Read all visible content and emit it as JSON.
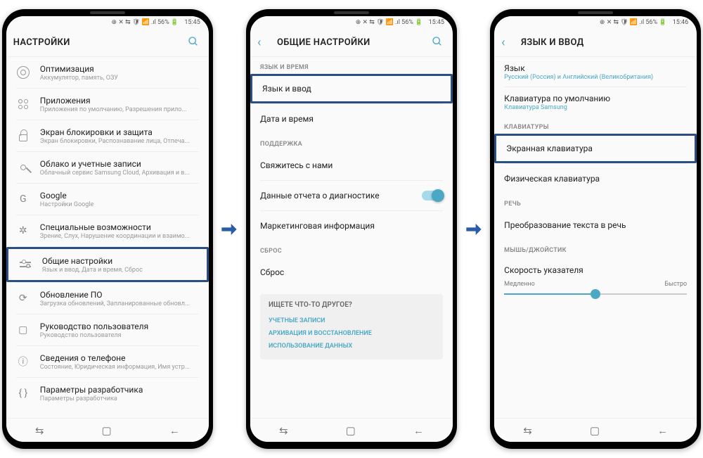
{
  "status": {
    "icons": "⊕ ✕ ⇆ 🛡 📶 .ıl 56% 🔋",
    "time1": "15:45",
    "time2": "15:45",
    "time3": "15:46"
  },
  "phone1": {
    "title": "НАСТРОЙКИ",
    "items": [
      {
        "title": "Оптимизация",
        "sub": "Аккумулятор, память, ОЗУ"
      },
      {
        "title": "Приложения",
        "sub": "Приложения по умолчанию, Разрешения прило..."
      },
      {
        "title": "Экран блокировки и защита",
        "sub": "Экран блокировки, Распознавание лица, Отпеча..."
      },
      {
        "title": "Облако и учетные записи",
        "sub": "Облачный сервис Samsung Cloud, Архивация и в..."
      },
      {
        "title": "Google",
        "sub": "Настройки Google"
      },
      {
        "title": "Специальные возможности",
        "sub": "Зрение, Слух, Нарушение координации и взаимо..."
      },
      {
        "title": "Общие настройки",
        "sub": "Язык и ввод, Дата и время, Сброс"
      },
      {
        "title": "Обновление ПО",
        "sub": "Загрузка обновлений, Запланированные обновл..."
      },
      {
        "title": "Руководство пользователя",
        "sub": "Руководство пользователя"
      },
      {
        "title": "Сведения о телефоне",
        "sub": "Состояние, Юридическая информация, Имя устр..."
      },
      {
        "title": "Параметры разработчика",
        "sub": "Параметры разработчика"
      }
    ]
  },
  "phone2": {
    "title": "ОБЩИЕ НАСТРОЙКИ",
    "sec1": "ЯЗЫК И ВРЕМЯ",
    "i1": "Язык и ввод",
    "i2": "Дата и время",
    "sec2": "ПОДДЕРЖКА",
    "i3": "Свяжитесь с нами",
    "i4": "Данные отчета о диагностике",
    "i5": "Маркетинговая информация",
    "sec3": "СБРОС",
    "i6": "Сброс",
    "sugTitle": "ИЩЕТЕ ЧТО-ТО ДРУГОЕ?",
    "sug1": "УЧЕТНЫЕ ЗАПИСИ",
    "sug2": "АРХИВАЦИЯ И ВОССТАНОВЛЕНИЕ",
    "sug3": "ИСПОЛЬЗОВАНИЕ ДАННЫХ"
  },
  "phone3": {
    "title": "ЯЗЫК И ВВОД",
    "i1t": "Язык",
    "i1s": "Русский (Россия) и Английский (Великобритания)",
    "i2t": "Клавиатура по умолчанию",
    "i2s": "Клавиатура Samsung",
    "sec1": "КЛАВИАТУРЫ",
    "i3": "Экранная клавиатура",
    "i4": "Физическая клавиатура",
    "sec2": "РЕЧЬ",
    "i5": "Преобразование текста в речь",
    "sec3": "МЫШЬ/ДЖОЙСТИК",
    "i6": "Скорость указателя",
    "slow": "Медленно",
    "fast": "Быстро"
  }
}
